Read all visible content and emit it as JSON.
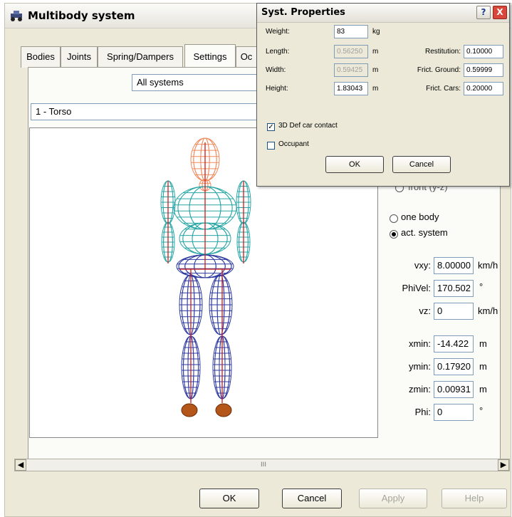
{
  "window": {
    "title": "Multibody system",
    "icon": "multibody-app-icon"
  },
  "tabs": [
    {
      "label": "Bodies"
    },
    {
      "label": "Joints"
    },
    {
      "label": "Spring/Dampers"
    },
    {
      "label": "Settings"
    },
    {
      "label": "Oc"
    }
  ],
  "active_tab": "Settings",
  "system_select": {
    "value": "All systems"
  },
  "body_select": {
    "value": "1 - Torso"
  },
  "view_partial_label": "front (y-z)",
  "radios": [
    {
      "label": "one body",
      "checked": false
    },
    {
      "label": "act. system",
      "checked": true
    }
  ],
  "fields": {
    "vxy": {
      "label": "vxy:",
      "value": "8.00000",
      "unit": "km/h"
    },
    "phivel": {
      "label": "PhiVel:",
      "value": "170.502",
      "unit": "°"
    },
    "vz": {
      "label": "vz:",
      "value": "0",
      "unit": "km/h"
    },
    "xmin": {
      "label": "xmin:",
      "value": "-14.422",
      "unit": "m"
    },
    "ymin": {
      "label": "ymin:",
      "value": "0.17920",
      "unit": "m"
    },
    "zmin": {
      "label": "zmin:",
      "value": "0.00931",
      "unit": "m"
    },
    "phi": {
      "label": "Phi:",
      "value": "0",
      "unit": "°"
    }
  },
  "scrollbar": {
    "thumb_label": "III"
  },
  "buttons": {
    "ok": "OK",
    "cancel": "Cancel",
    "apply": "Apply",
    "help": "Help"
  },
  "dialog": {
    "title": "Syst. Properties",
    "help_glyph": "?",
    "close_glyph": "X",
    "weight": {
      "label": "Weight:",
      "value": "83",
      "unit": "kg"
    },
    "length": {
      "label": "Length:",
      "value": "0.56250",
      "unit": "m"
    },
    "width": {
      "label": "Width:",
      "value": "0.59425",
      "unit": "m"
    },
    "height": {
      "label": "Height:",
      "value": "1.83043",
      "unit": "m"
    },
    "restitution": {
      "label": "Restitution:",
      "value": "0.10000"
    },
    "frict_ground": {
      "label": "Frict. Ground:",
      "value": "0.59999"
    },
    "frict_cars": {
      "label": "Frict. Cars:",
      "value": "0.20000"
    },
    "cb_3d": {
      "label": "3D Def car contact",
      "checked": true
    },
    "cb_occupant": {
      "label": "Occupant",
      "checked": false
    },
    "ok": "OK",
    "cancel": "Cancel"
  },
  "colors": {
    "head": "#f08a5d",
    "arms_torso": "#2aa6a6",
    "legs": "#2e3aa0",
    "spine": "#d01818",
    "feet": "#b4551a",
    "dialog_close": "#d9463a"
  }
}
